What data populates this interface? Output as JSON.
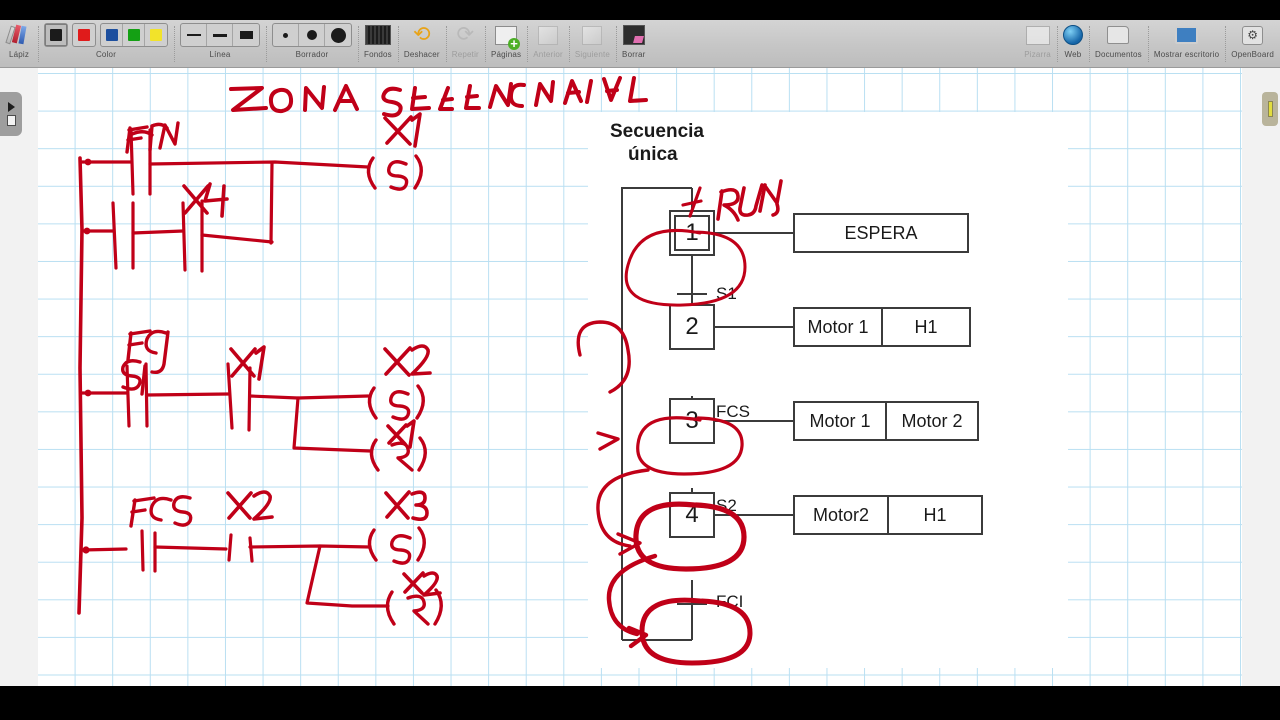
{
  "app": {
    "name": "OpenBoard"
  },
  "toolbar": {
    "groups": [
      {
        "name": "pencil",
        "label": "Lápiz"
      },
      {
        "name": "color",
        "label": "Color"
      },
      {
        "name": "line",
        "label": "Línea"
      },
      {
        "name": "eraser",
        "label": "Borrador"
      }
    ],
    "buttons": [
      {
        "name": "fondos",
        "label": "Fondos",
        "enabled": true
      },
      {
        "name": "deshacer",
        "label": "Deshacer",
        "enabled": true
      },
      {
        "name": "repetir",
        "label": "Repetir",
        "enabled": false
      },
      {
        "name": "paginas",
        "label": "Páginas",
        "enabled": true
      },
      {
        "name": "anterior",
        "label": "Anterior",
        "enabled": false
      },
      {
        "name": "siguiente",
        "label": "Siguiente",
        "enabled": false
      },
      {
        "name": "borrar",
        "label": "Borrar",
        "enabled": true
      }
    ],
    "right_buttons": [
      {
        "name": "pizarra",
        "label": "Pizarra",
        "enabled": false
      },
      {
        "name": "web",
        "label": "Web",
        "enabled": true
      },
      {
        "name": "documentos",
        "label": "Documentos",
        "enabled": true
      },
      {
        "name": "escritorio",
        "label": "Mostrar escritorio",
        "enabled": true
      },
      {
        "name": "openboard",
        "label": "OpenBoard",
        "enabled": true
      }
    ],
    "colors": [
      {
        "name": "black",
        "hex": "#1b1b1b",
        "selected": true
      },
      {
        "name": "red",
        "hex": "#e01b1b",
        "selected": false
      },
      {
        "name": "blue",
        "hex": "#1d4f9e",
        "selected": false
      },
      {
        "name": "green",
        "hex": "#14a014",
        "selected": false
      },
      {
        "name": "yellow",
        "hex": "#f2e32a",
        "selected": false
      }
    ]
  },
  "ink": {
    "color": "#c00018",
    "title": "ZONA SECUENCIAL",
    "ladder": {
      "rungs": [
        {
          "contacts": [
            "FIN",
            "X4"
          ],
          "coil": "X1",
          "coil_type": "(S)"
        },
        {
          "contacts": [
            "FCI / S1",
            "X1"
          ],
          "coil": "X2",
          "coil_type": "(S)",
          "coil2": "X1",
          "coil2_type": "(R)"
        },
        {
          "contacts": [
            "FCS",
            "X2"
          ],
          "coil": "X3",
          "coil_type": "(S)",
          "coil2": "X2",
          "coil2_type": "(R)"
        }
      ],
      "labels": [
        "FIN",
        "X4",
        "X1",
        "FCI",
        "S1",
        "X1",
        "X2",
        "X1",
        "FCS",
        "X2",
        "X3",
        "X2"
      ]
    },
    "annotations": [
      "RUN"
    ],
    "marks": [
      "arrow-to-step-1",
      "arrow-to-step-2",
      "arrow-to-step-3",
      "arrow-to-step-4",
      "circle-step-1",
      "circle-step-2",
      "circle-step-3",
      "circle-step-4"
    ]
  },
  "sfc": {
    "title_line1": "Secuencia",
    "title_line2": "única",
    "steps": [
      {
        "id": "1",
        "initial": true,
        "actions": [
          "ESPERA"
        ],
        "transition_after": "S1"
      },
      {
        "id": "2",
        "initial": false,
        "actions": [
          "Motor 1",
          "H1"
        ],
        "transition_after": "FCS"
      },
      {
        "id": "3",
        "initial": false,
        "actions": [
          "Motor 1",
          "Motor 2"
        ],
        "transition_after": "S2"
      },
      {
        "id": "4",
        "initial": false,
        "actions": [
          "Motor2",
          "H1"
        ],
        "transition_after": "FCI"
      }
    ]
  }
}
